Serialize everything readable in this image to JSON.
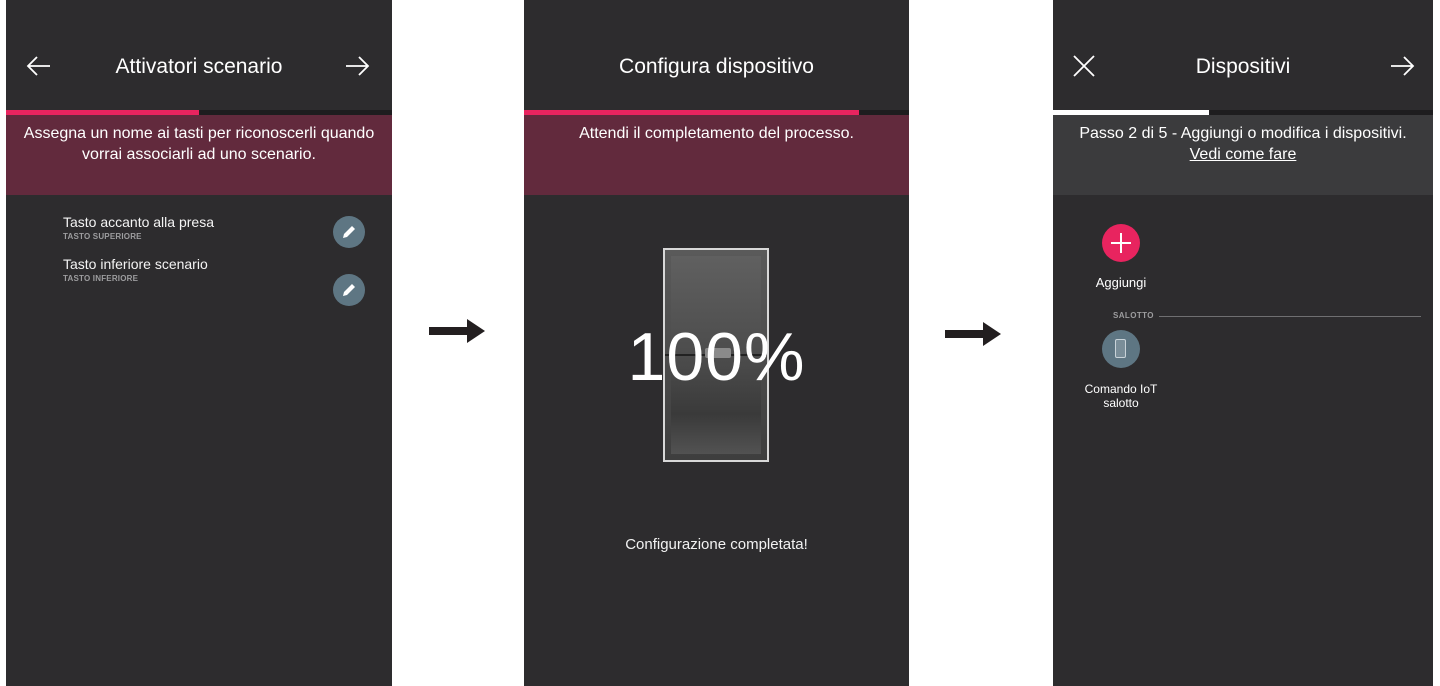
{
  "colors": {
    "screen_bg": "#2d2c2e",
    "accent": "#e8245f",
    "banner_pink": "#622a3d",
    "banner_grey": "#3b3b3d",
    "icon_grey": "#5e7683"
  },
  "screen1": {
    "title": "Attivatori scenario",
    "back_icon": "arrow-left-icon",
    "next_icon": "arrow-right-icon",
    "progress": 0.5,
    "banner": "Assegna un nome ai tasti per riconoscerli quando vorrai associarli ad uno scenario.",
    "items": [
      {
        "name": "Tasto accanto alla presa",
        "sub": "TASTO SUPERIORE",
        "icon": "pencil-icon"
      },
      {
        "name": "Tasto inferiore scenario",
        "sub": "TASTO INFERIORE",
        "icon": "pencil-icon"
      }
    ]
  },
  "screen2": {
    "title": "Configura dispositivo",
    "progress": 0.87,
    "banner": "Attendi il completamento del processo.",
    "percent": "100%",
    "status": "Configurazione completata!"
  },
  "screen3": {
    "title": "Dispositivi",
    "close_icon": "close-icon",
    "next_icon": "arrow-right-icon",
    "progress": 0.41,
    "banner": "Passo 2 di 5 - Aggiungi o modifica i dispositivi.",
    "banner_link": "Vedi come fare",
    "add_label": "Aggiungi",
    "section": "SALOTTO",
    "device_label_line1": "Comando IoT",
    "device_label_line2": "salotto"
  },
  "flow_arrow_icon": "arrow-right-icon"
}
